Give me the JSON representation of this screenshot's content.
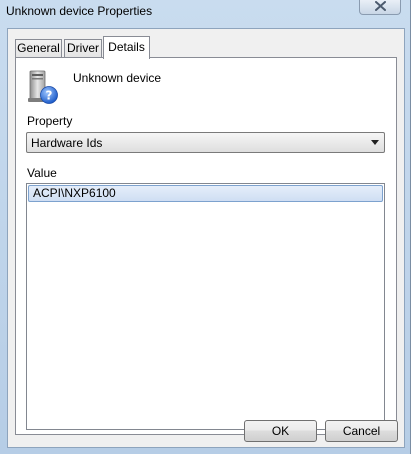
{
  "window": {
    "title": "Unknown device Properties",
    "close_icon": "close-icon"
  },
  "tabs": [
    {
      "label": "General",
      "active": false
    },
    {
      "label": "Driver",
      "active": false
    },
    {
      "label": "Details",
      "active": true
    }
  ],
  "details": {
    "device_icon": "unknown-device-icon",
    "device_name": "Unknown device",
    "property_label": "Property",
    "property_selected": "Hardware Ids",
    "value_label": "Value",
    "values": [
      "ACPI\\NXP6100"
    ]
  },
  "buttons": {
    "ok": "OK",
    "cancel": "Cancel"
  },
  "colors": {
    "selection_border": "#7da2ce",
    "selection_fill": "#dce7f7",
    "frame": "#b9d1ea"
  }
}
